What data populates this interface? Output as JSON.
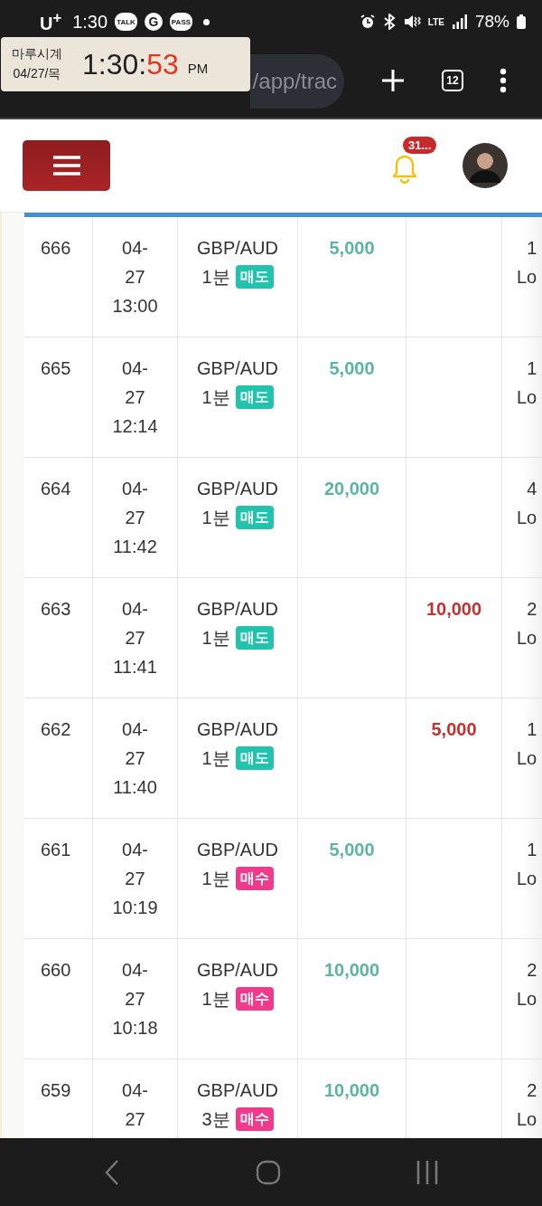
{
  "status_bar": {
    "carrier": "U$^{+}$",
    "time": "1:30",
    "app_badges": [
      "TALK",
      "G",
      "PASS"
    ],
    "network": "LTE",
    "battery": "78%"
  },
  "browser": {
    "url": "/app/trac",
    "tab_count": "12"
  },
  "clock_widget": {
    "title": "마루시계",
    "date": "04/27/목",
    "time": "1:30:",
    "seconds": "53",
    "ampm": "PM"
  },
  "header": {
    "notification_count": "31..."
  },
  "rows": [
    {
      "id": "666",
      "datetime": "04-27 13:00",
      "pair": "GBP/AUD",
      "interval": "1분",
      "color": "#22c3ad",
      "side_label": "매도",
      "profit": "5,000",
      "column_6": "1 Lo"
    },
    {
      "id": "665",
      "datetime": "04-27 12:14",
      "pair": "GBP/AUD",
      "interval": "1분",
      "color": "#22c3ad",
      "side_label": "매도",
      "profit": "5,000",
      "column_6": "1 Lo"
    },
    {
      "id": "664",
      "datetime": "04-27 11:42",
      "pair": "GBP/AUD",
      "interval": "1분",
      "color": "#22c3ad",
      "side_label": "매도",
      "profit": "20,000",
      "column_6": "4 Lo"
    },
    {
      "id": "663",
      "datetime": "04-27 11:41",
      "pair": "GBP/AUD",
      "interval": "1분",
      "color": "#22c3ad",
      "side_label": "매도",
      "loss": "10,000",
      "column_6": "2 Lo"
    },
    {
      "id": "662",
      "datetime": "04-27 11:40",
      "pair": "GBP/AUD",
      "interval": "1분",
      "color": "#22c3ad",
      "side_label": "매도",
      "loss": "5,000",
      "column_6": "1 Lo"
    },
    {
      "id": "661",
      "datetime": "04-27 10:19",
      "pair": "GBP/AUD",
      "interval": "1분",
      "color": "#f23a8c",
      "side_label": "매수",
      "profit": "5,000",
      "column_6": "1 Lo"
    },
    {
      "id": "660",
      "datetime": "04-27 10:18",
      "pair": "GBP/AUD",
      "interval": "1분",
      "color": "#f23a8c",
      "side_label": "매수",
      "profit": "10,000",
      "column_6": "2 Lo"
    },
    {
      "id": "659",
      "datetime": "04-27",
      "pair": "GBP/AUD",
      "interval": "3분",
      "color": "#f23a8c",
      "side_label": "매수",
      "profit": "10,000",
      "column_6": "2 Lo"
    }
  ]
}
